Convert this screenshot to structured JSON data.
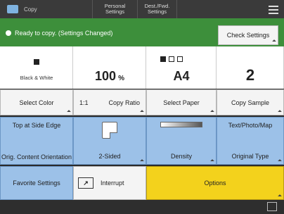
{
  "topbar": {
    "copy_label": "Copy",
    "personal_settings": "Personal Settings",
    "unnamed_settings": "Dest./Fwd. Settings"
  },
  "status": {
    "message": "Ready to copy. (Settings Changed)",
    "check_settings": "Check Settings"
  },
  "info": {
    "color_mode": "Black & White",
    "ratio_value": "100",
    "ratio_unit": "%",
    "paper_size": "A4",
    "copies": "2"
  },
  "row1": {
    "select_color": "Select Color",
    "ratio_prefix": "1:1",
    "copy_ratio": "Copy Ratio",
    "select_paper": "Select Paper",
    "copy_sample": "Copy Sample"
  },
  "row2": {
    "orig_top": "Top at Side Edge",
    "orig_label": "Orig. Content Orientation",
    "two_sided": "2-Sided",
    "density": "Density",
    "original_type_value": "Text/Photo/Map",
    "original_type": "Original Type"
  },
  "row3": {
    "favorite": "Favorite Settings",
    "interrupt": "Interrupt",
    "options": "Options"
  },
  "colors": {
    "status_green": "#3d8f3b",
    "function_blue": "#9cc1e8",
    "options_yellow": "#f3d21c"
  }
}
